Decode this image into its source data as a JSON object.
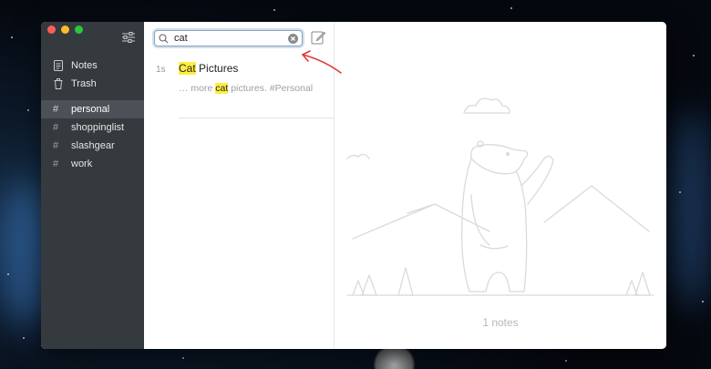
{
  "window": {
    "controls": [
      "close",
      "minimize",
      "zoom"
    ]
  },
  "sidebar": {
    "settings_icon": "sliders-icon",
    "nav": [
      {
        "label": "Notes",
        "icon": "note-icon"
      },
      {
        "label": "Trash",
        "icon": "trash-icon"
      }
    ],
    "tags": [
      {
        "label": "personal",
        "active": true
      },
      {
        "label": "shoppinglist",
        "active": false
      },
      {
        "label": "slashgear",
        "active": false
      },
      {
        "label": "work",
        "active": false
      }
    ]
  },
  "search": {
    "value": "cat",
    "icon": "search-icon",
    "clear_icon": "clear-icon"
  },
  "compose_icon": "compose-icon",
  "note": {
    "age": "1s",
    "title_highlight": "Cat",
    "title_rest": " Pictures",
    "snippet_prefix": "… more ",
    "snippet_highlight": "cat",
    "snippet_suffix": " pictures.  #Personal"
  },
  "detail": {
    "count_text": "1 notes"
  },
  "colors": {
    "sidebar_bg": "#353a3e",
    "highlight": "#ffee40",
    "arrow": "#e03a3a"
  }
}
